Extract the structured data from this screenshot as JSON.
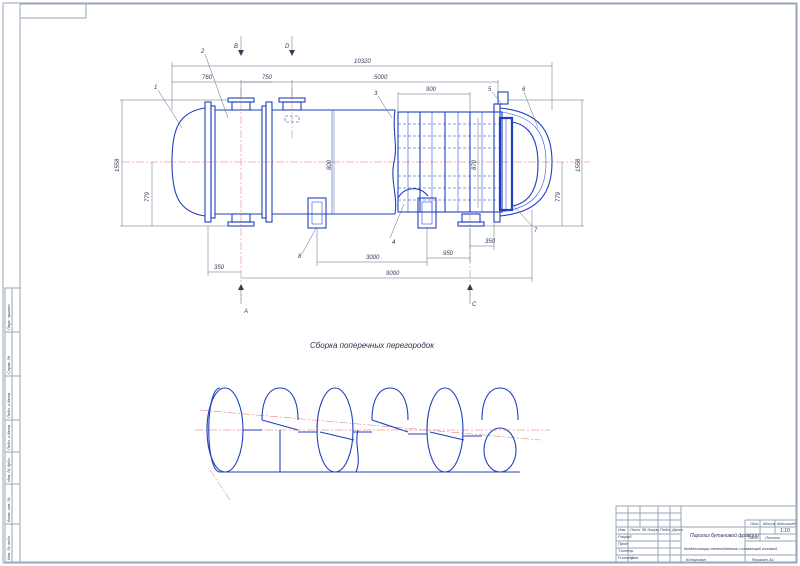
{
  "drawing": {
    "section_title": "Сборка поперечных перегородок",
    "views": {
      "view_b": "В",
      "view_d": "D",
      "view_a": "А",
      "view_c": "С"
    },
    "dimensions": {
      "overall_length": "10320",
      "d760": "760",
      "d750": "750",
      "d5000": "5000",
      "d900": "900",
      "left_height": "1558",
      "right_height": "1558",
      "left_779": "779",
      "right_779": "779",
      "d800": "800",
      "d870": "870",
      "d350_left": "350",
      "d350_right": "350",
      "d3000": "3000",
      "d950": "950",
      "d9000": "9000"
    },
    "leaders": {
      "p1": "1",
      "p2": "2",
      "p3": "3",
      "p4": "4",
      "p5": "5",
      "p6": "6",
      "p7": "7",
      "p8": "8"
    }
  },
  "side_stamps": [
    "Перв. примен.",
    "Справ. №",
    "Подп. и дата",
    "Инв. № дубл.",
    "Взам. инв. №",
    "Подп. и дата",
    "Инв. № подл."
  ],
  "title_block": {
    "doc_title": "Пиролиз бутановой фракции",
    "part_name": "Конденсаторы теплообменник с плавающей головкой",
    "scale_value": "1:10",
    "mass_header": "Масса",
    "scale_header": "Масштаб",
    "lit_header": "Лит.",
    "sheet_label": "Лист",
    "sheets_label": "Листов",
    "row_labels": [
      "Изм.",
      "Лист",
      "№ докум.",
      "Подп.",
      "Дата",
      "Разраб.",
      "Пров.",
      "Т.контр.",
      "Н.контр.",
      "Утв."
    ],
    "copied": "Копировал",
    "format": "Формат    А1"
  }
}
